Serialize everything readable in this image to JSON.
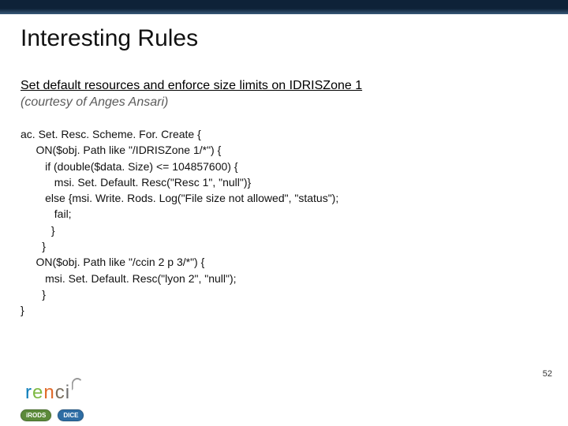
{
  "title": "Interesting Rules",
  "subheading": "Set default resources and enforce size limits on IDRISZone 1",
  "courtesy": "(courtesy of Anges Ansari)",
  "code": "ac. Set. Resc. Scheme. For. Create {\n     ON($obj. Path like \"/IDRISZone 1/*\") {\n        if (double($data. Size) <= 104857600) {\n           msi. Set. Default. Resc(\"Resc 1\", \"null\")}\n        else {msi. Write. Rods. Log(\"File size not allowed\", \"status\");\n           fail;\n          }\n       }\n     ON($obj. Path like \"/ccin 2 p 3/*\") {\n        msi. Set. Default. Resc(\"lyon 2\", \"null\");\n       }\n}",
  "page_number": "52",
  "logo": {
    "text": "renci",
    "badge1": "iRODS",
    "badge2": "DICE"
  }
}
